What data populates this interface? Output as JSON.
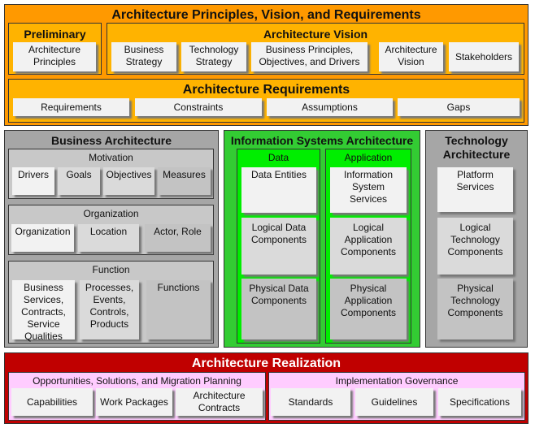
{
  "colors": {
    "orange": "#ff9900",
    "light_orange": "#ffb300",
    "gray": "#a6a6a6",
    "light_gray": "#c8c8c8",
    "green": "#33cc33",
    "bright_green": "#00ee00",
    "red": "#c00000",
    "pink": "#ffccff"
  },
  "top": {
    "title": "Architecture Principles, Vision, and Requirements",
    "preliminary": {
      "title": "Preliminary",
      "items": [
        "Architecture Principles"
      ]
    },
    "vision": {
      "title": "Architecture Vision",
      "items": [
        "Business Strategy",
        "Technology Strategy",
        "Business Principles, Objectives, and Drivers",
        "Architecture Vision",
        "Stakeholders"
      ]
    },
    "requirements": {
      "title": "Architecture  Requirements",
      "items": [
        "Requirements",
        "Constraints",
        "Assumptions",
        "Gaps"
      ]
    }
  },
  "business": {
    "title": "Business  Architecture",
    "motivation": {
      "title": "Motivation",
      "items": [
        "Drivers",
        "Goals",
        "Objectives",
        "Measures"
      ]
    },
    "organization": {
      "title": "Organization",
      "items": [
        "Organization",
        "Location",
        "Actor, Role"
      ]
    },
    "function": {
      "title": "Function",
      "items": [
        "Business Services, Contracts, Service Qualities",
        "Processes, Events, Controls, Products",
        "Functions"
      ]
    }
  },
  "isa": {
    "title": "Information  Systems Architecture",
    "data": {
      "title": "Data",
      "items": [
        "Data Entities",
        "Logical Data Components",
        "Physical Data Components"
      ]
    },
    "application": {
      "title": "Application",
      "items": [
        "Information System Services",
        "Logical Application Components",
        "Physical Application Components"
      ]
    }
  },
  "technology": {
    "title": "Technology Architecture",
    "items": [
      "Platform Services",
      "Logical Technology Components",
      "Physical Technology Components"
    ]
  },
  "realization": {
    "title": "Architecture  Realization",
    "opportunities": {
      "title": "Opportunities, Solutions, and Migration Planning",
      "items": [
        "Capabilities",
        "Work Packages",
        "Architecture Contracts"
      ]
    },
    "governance": {
      "title": "Implementation Governance",
      "items": [
        "Standards",
        "Guidelines",
        "Specifications"
      ]
    }
  }
}
